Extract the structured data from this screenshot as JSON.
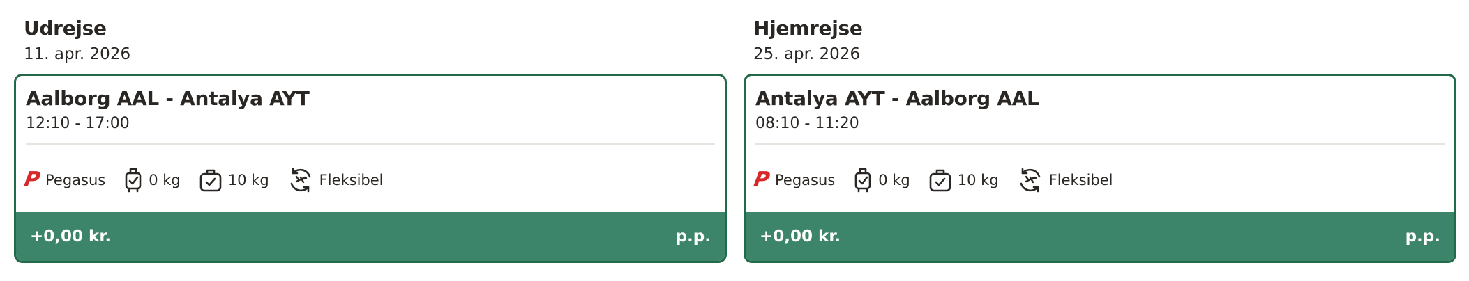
{
  "outbound": {
    "heading": "Udrejse",
    "date": "11. apr. 2026",
    "route": "Aalborg AAL - Antalya AYT",
    "time": "12:10 - 17:00",
    "airline": "Pegasus",
    "airline_logo_letter": "P",
    "hand_baggage": "0 kg",
    "checked_baggage": "10 kg",
    "flex": "Fleksibel",
    "price": "+0,00 kr.",
    "per_person": "p.p."
  },
  "return": {
    "heading": "Hjemrejse",
    "date": "25. apr. 2026",
    "route": "Antalya AYT - Aalborg AAL",
    "time": "08:10 - 11:20",
    "airline": "Pegasus",
    "airline_logo_letter": "P",
    "hand_baggage": "0 kg",
    "checked_baggage": "10 kg",
    "flex": "Fleksibel",
    "price": "+0,00 kr.",
    "per_person": "p.p."
  },
  "colors": {
    "accent_green": "#3d856a",
    "border_green": "#226a4a",
    "airline_red": "#d8282a"
  },
  "icons": [
    "pegasus-logo-icon",
    "hand-luggage-icon",
    "checked-luggage-icon",
    "flexible-ticket-icon"
  ]
}
